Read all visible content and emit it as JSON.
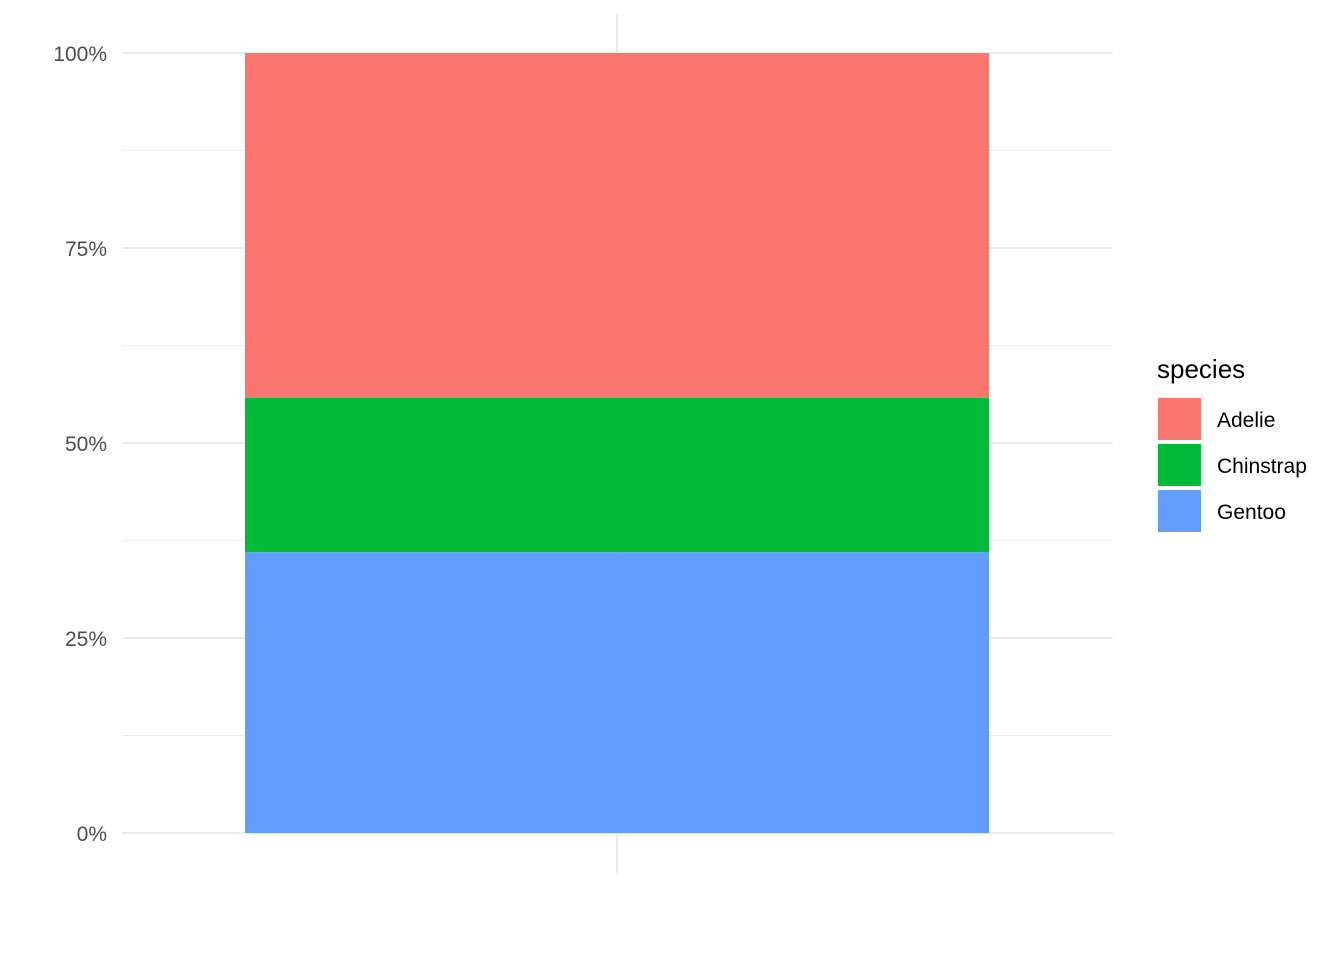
{
  "chart_data": {
    "type": "bar",
    "stacked": true,
    "position": "fill",
    "categories": [
      ""
    ],
    "series": [
      {
        "name": "Adelie",
        "values": [
          0.442
        ],
        "color": "#F8766D"
      },
      {
        "name": "Chinstrap",
        "values": [
          0.198
        ],
        "color": "#00BA38"
      },
      {
        "name": "Gentoo",
        "values": [
          0.36
        ],
        "color": "#619CFF"
      }
    ],
    "title": "",
    "xlabel": "",
    "ylabel": "",
    "ylim": [
      0,
      1
    ],
    "y_ticks": [
      {
        "value": 0,
        "label": "0%"
      },
      {
        "value": 0.25,
        "label": "25%"
      },
      {
        "value": 0.5,
        "label": "50%"
      },
      {
        "value": 0.75,
        "label": "75%"
      },
      {
        "value": 1,
        "label": "100%"
      }
    ],
    "y_minor_ticks": [
      0.125,
      0.375,
      0.625,
      0.875
    ],
    "grid": true,
    "legend": {
      "title": "species",
      "placement": "right"
    },
    "colors": {
      "grid": "#EBEBEB",
      "tick_text": "#4D4D4D",
      "background": "#FFFFFF"
    }
  }
}
